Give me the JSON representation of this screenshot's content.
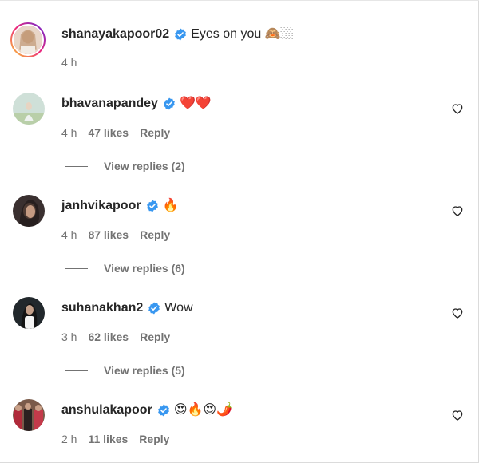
{
  "comments": [
    {
      "username": "shanayakapoor02",
      "text": "Eyes on you 🙈🏼",
      "time": "4 h",
      "likes": "",
      "reply": "",
      "view_replies": ""
    },
    {
      "username": "bhavanapandey",
      "text": "❤️❤️",
      "time": "4 h",
      "likes": "47 likes",
      "reply": "Reply",
      "view_replies": "View replies (2)"
    },
    {
      "username": "janhvikapoor",
      "text": "🔥",
      "time": "4 h",
      "likes": "87 likes",
      "reply": "Reply",
      "view_replies": "View replies (6)"
    },
    {
      "username": "suhanakhan2",
      "text": "Wow",
      "time": "3 h",
      "likes": "62 likes",
      "reply": "Reply",
      "view_replies": "View replies (5)"
    },
    {
      "username": "anshulakapoor",
      "text": "😍🔥😍🌶️",
      "time": "2 h",
      "likes": "11 likes",
      "reply": "Reply",
      "view_replies": ""
    }
  ],
  "colors": {
    "verified": "#3897f0",
    "secondary_text": "#737373",
    "primary_text": "#262626"
  }
}
